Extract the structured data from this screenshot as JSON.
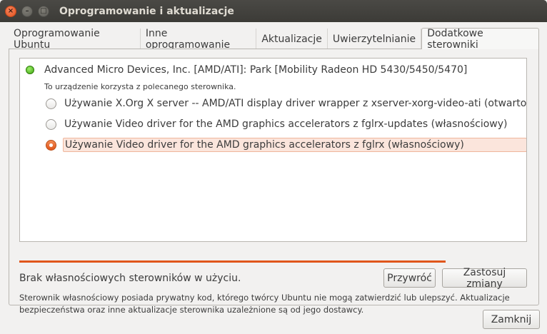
{
  "window": {
    "title": "Oprogramowanie i aktualizacje",
    "close_glyph": "×",
    "minimize_glyph": "–",
    "maximize_glyph": "□"
  },
  "tabs": [
    {
      "label": "Oprogramowanie Ubuntu"
    },
    {
      "label": "Inne oprogramowanie"
    },
    {
      "label": "Aktualizacje"
    },
    {
      "label": "Uwierzytelnianie"
    },
    {
      "label": "Dodatkowe sterowniki"
    }
  ],
  "active_tab": "Dodatkowe sterowniki",
  "device": {
    "name": "Advanced Micro Devices, Inc. [AMD/ATI]: Park [Mobility Radeon HD 5430/5450/5470]",
    "status": "To urządzenie korzysta z polecanego sterownika.",
    "status_led_color": "#4caf1a"
  },
  "driver_options": [
    {
      "label": "Używanie X.Org X server -- AMD/ATI display driver wrapper z xserver-xorg-video-ati (otwartoźródłowy)",
      "selected": false
    },
    {
      "label": "Używanie Video driver for the AMD graphics accelerators z fglrx-updates (własnościowy)",
      "selected": false
    },
    {
      "label": "Używanie Video driver for the AMD graphics accelerators z fglrx (własnościowy)",
      "selected": true
    }
  ],
  "progress_fraction": 0.84,
  "status_text": "Brak własnościowych sterowników w użyciu.",
  "buttons": {
    "revert": "Przywróć",
    "apply": "Zastosuj zmiany",
    "close": "Zamknij"
  },
  "note": "Sterownik własnościowy posiada prywatny kod, którego twórcy Ubuntu nie mogą zatwierdzić lub ulepszyć. Aktualizacje bezpieczeństwa oraz inne aktualizacje sterownika uzależnione są od jego dostawcy.",
  "colors": {
    "accent": "#e0561b",
    "titlebar": "#3c3b37",
    "selected_row": "#fbe5dc"
  }
}
